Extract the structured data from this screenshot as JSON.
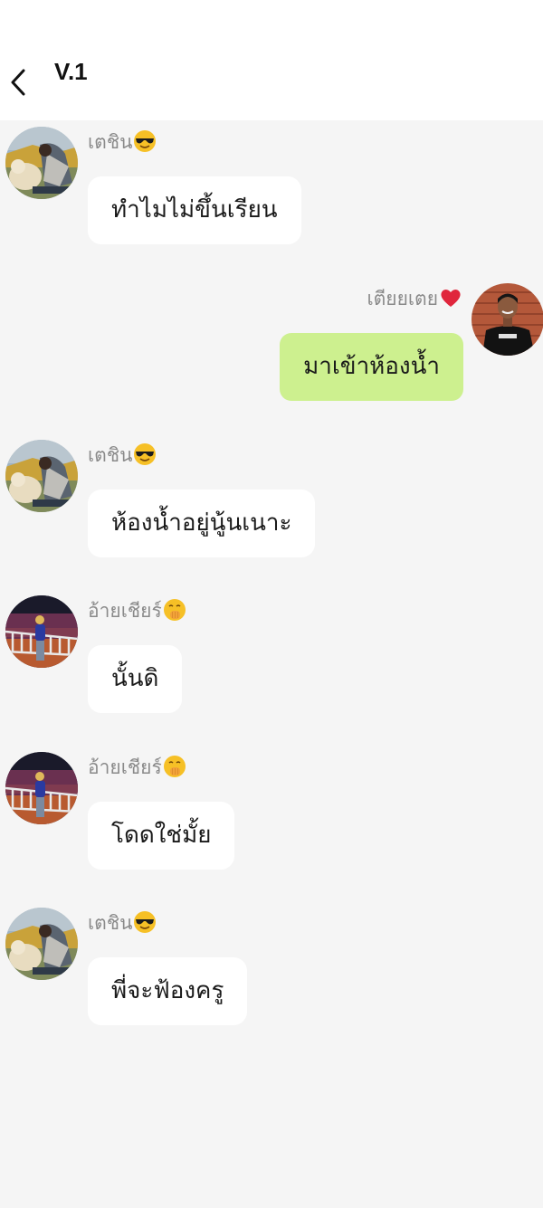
{
  "header": {
    "title": "V.1",
    "back_icon": "chevron-left-icon"
  },
  "colors": {
    "background": "#f5f5f5",
    "incoming_bubble": "#ffffff",
    "outgoing_bubble": "#cdf08f",
    "sender_name": "#8a8a8a"
  },
  "messages": [
    {
      "sender": "เตชิน",
      "sender_emoji": "sunglasses-face-emoji",
      "text": "ทำไมไม่ขึ้นเรียน",
      "direction": "incoming"
    },
    {
      "sender": "เตียยเตย",
      "sender_emoji": "red-heart-emoji",
      "text": "มาเข้าห้องน้ำ",
      "direction": "outgoing"
    },
    {
      "sender": "เตชิน",
      "sender_emoji": "sunglasses-face-emoji",
      "text": "ห้องน้ำอยู่นู้นเนาะ",
      "direction": "incoming"
    },
    {
      "sender": "อ้ายเชียร์",
      "sender_emoji": "hand-over-mouth-emoji",
      "text": "นั้นดิ",
      "direction": "incoming"
    },
    {
      "sender": "อ้ายเชียร์",
      "sender_emoji": "hand-over-mouth-emoji",
      "text": "โดดใช่มั้ย",
      "direction": "incoming"
    },
    {
      "sender": "เตชิน",
      "sender_emoji": "sunglasses-face-emoji",
      "text": "พี่จะฟ้องครู",
      "direction": "incoming"
    }
  ]
}
